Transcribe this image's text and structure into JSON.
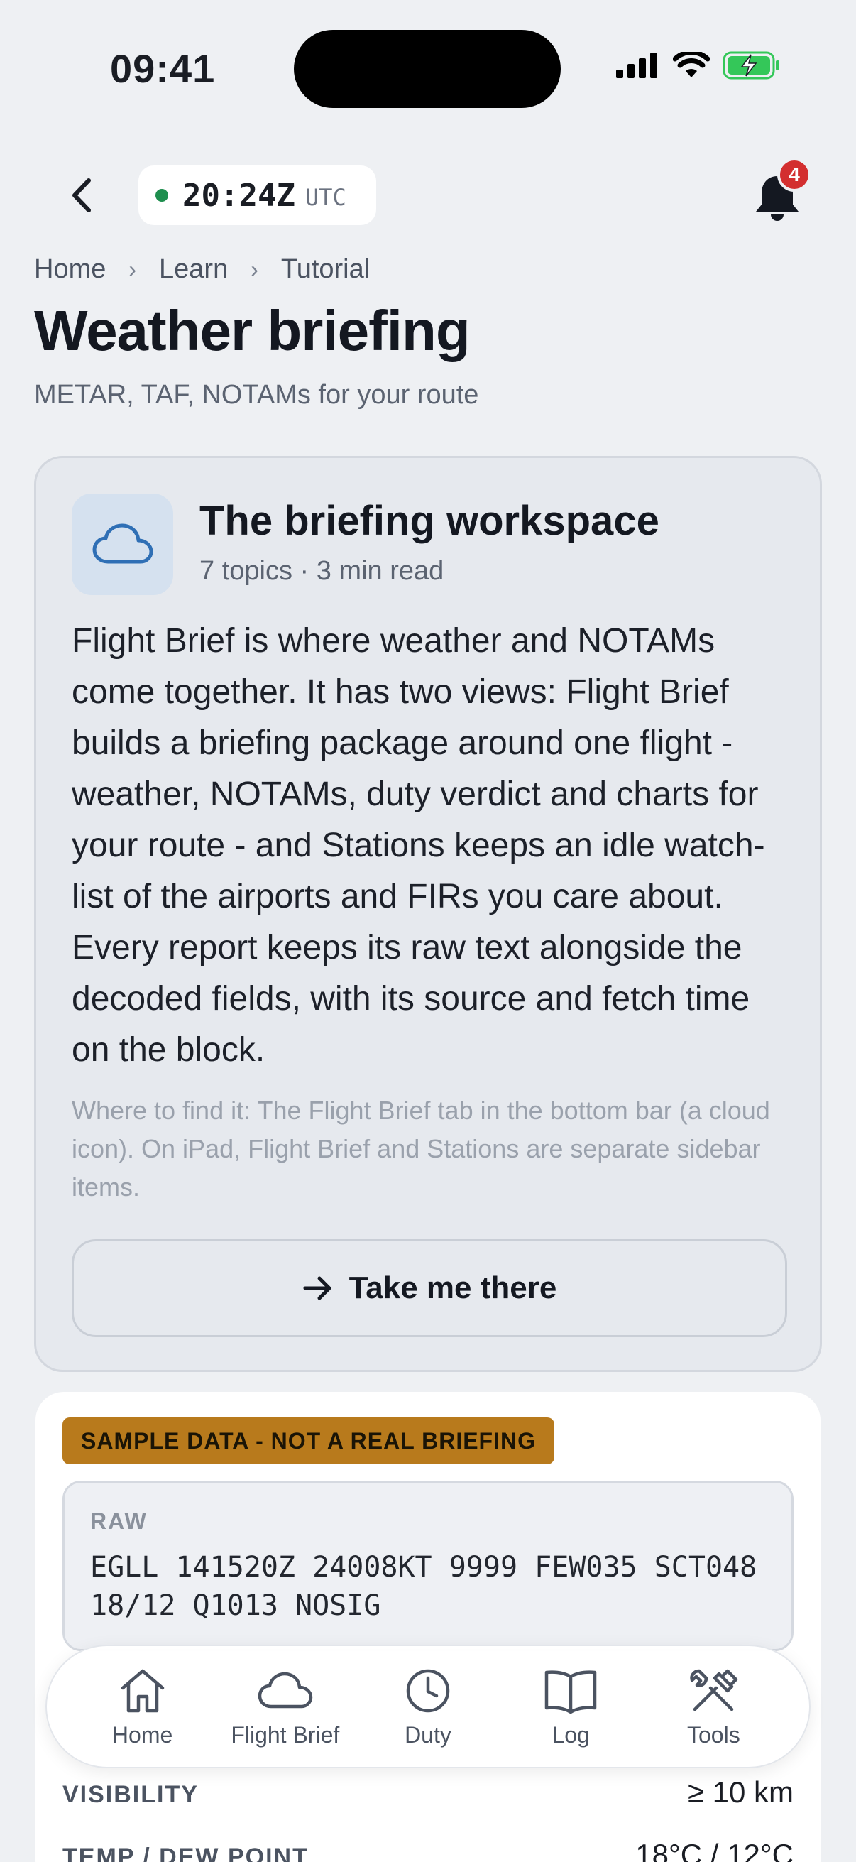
{
  "status_bar": {
    "time": "09:41"
  },
  "top_bar": {
    "utc_time": "20:24Z",
    "utc_label": "UTC",
    "notification_count": "4"
  },
  "breadcrumb": [
    "Home",
    "Learn",
    "Tutorial"
  ],
  "page": {
    "title": "Weather briefing",
    "subtitle": "METAR, TAF, NOTAMs for your route"
  },
  "card": {
    "icon": "cloud-icon",
    "title": "The briefing workspace",
    "meta": "7 topics · 3 min read",
    "body": "Flight Brief is where weather and NOTAMs come together. It has two views: Flight Brief builds a briefing package around one flight - weather, NOTAMs, duty verdict and charts for your route - and Stations keeps an idle watch-list of the airports and FIRs you care about. Every report keeps its raw text alongside the decoded fields, with its source and fetch time on the block.",
    "hint": "Where to find it: The Flight Brief tab in the bottom bar (a cloud icon). On iPad, Flight Brief and Stations are separate sidebar items.",
    "cta_label": "Take me there"
  },
  "sample": {
    "badge": "SAMPLE DATA - NOT A REAL BRIEFING",
    "raw_label": "RAW",
    "raw_text": "EGLL 141520Z 24008KT 9999 FEW035 SCT048 18/12 Q1013 NOSIG",
    "rows": [
      {
        "label": "VISIBILITY",
        "value": "≥ 10 km"
      },
      {
        "label": "TEMP / DEW POINT",
        "value": "18°C / 12°C"
      }
    ]
  },
  "tab_bar": {
    "tabs": [
      {
        "label": "Home",
        "icon": "home-icon"
      },
      {
        "label": "Flight Brief",
        "icon": "cloud-icon"
      },
      {
        "label": "Duty",
        "icon": "clock-icon"
      },
      {
        "label": "Log",
        "icon": "book-icon"
      },
      {
        "label": "Tools",
        "icon": "tools-icon"
      }
    ]
  },
  "colors": {
    "background": "#eef0f3",
    "accent_green": "#1e8e4e",
    "badge_red": "#d32f2f",
    "sample_badge": "#b87a1c",
    "icon_blue": "#2f6fb5"
  }
}
